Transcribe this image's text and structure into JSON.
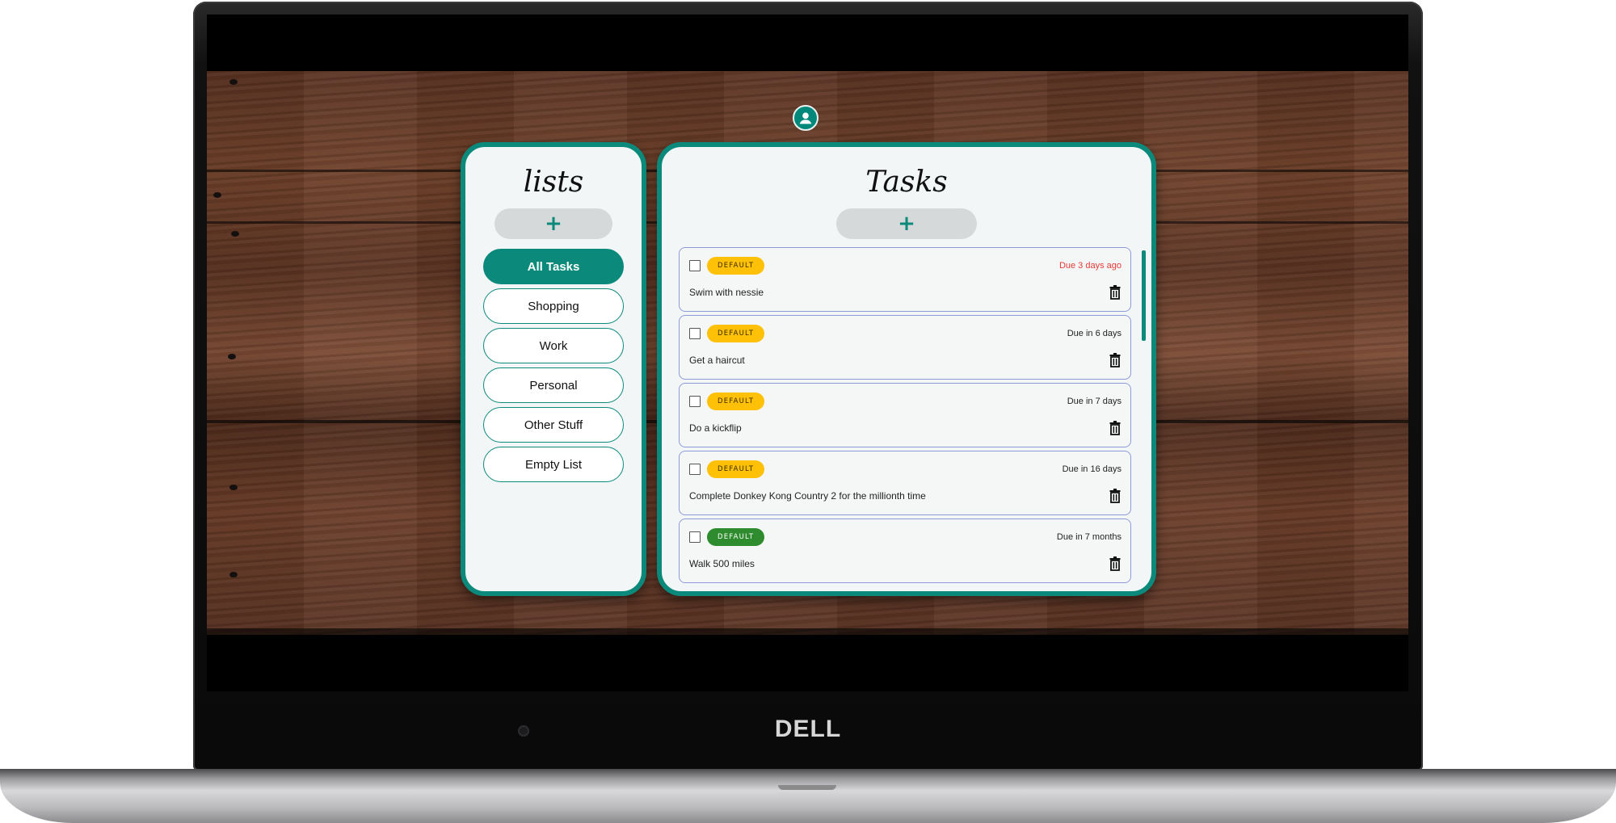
{
  "device": {
    "brand": "DELL"
  },
  "colors": {
    "accent": "#0b8a7c",
    "badge_yellow": "#ffc107",
    "badge_green": "#2e8b2e",
    "overdue_red": "#e53935"
  },
  "header": {
    "avatar_icon": "user-avatar-icon"
  },
  "lists_panel": {
    "title": "lists",
    "add_label": "+",
    "items": [
      {
        "label": "All Tasks",
        "active": true
      },
      {
        "label": "Shopping"
      },
      {
        "label": "Work"
      },
      {
        "label": "Personal"
      },
      {
        "label": "Other Stuff"
      },
      {
        "label": "Empty List"
      }
    ]
  },
  "tasks_panel": {
    "title": "Tasks",
    "add_label": "+",
    "tasks": [
      {
        "badge": "DEFAULT",
        "badge_color": "yellow",
        "due": "Due 3 days ago",
        "overdue": true,
        "title": "Swim with nessie"
      },
      {
        "badge": "DEFAULT",
        "badge_color": "yellow",
        "due": "Due in 6 days",
        "title": "Get a haircut"
      },
      {
        "badge": "DEFAULT",
        "badge_color": "yellow",
        "due": "Due in 7 days",
        "title": "Do a kickflip"
      },
      {
        "badge": "DEFAULT",
        "badge_color": "yellow",
        "due": "Due in 16 days",
        "title": "Complete Donkey Kong Country 2 for the millionth time"
      },
      {
        "badge": "DEFAULT",
        "badge_color": "green",
        "due": "Due in 7 months",
        "title": "Walk 500 miles"
      }
    ]
  }
}
